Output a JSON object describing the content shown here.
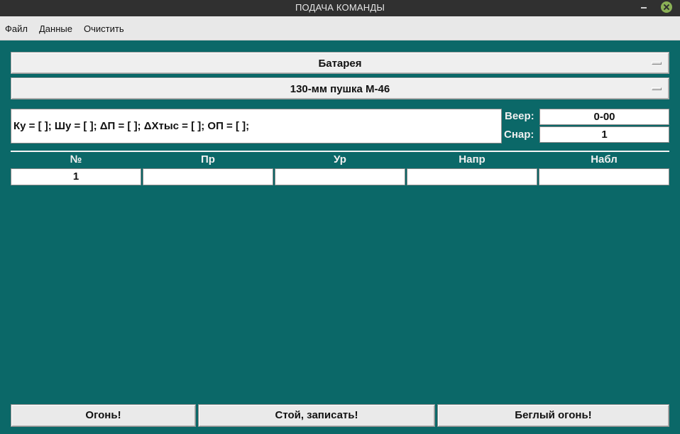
{
  "window": {
    "title": "ПОДАЧА КОМАНДЫ"
  },
  "menu": [
    "Файл",
    "Данные",
    "Очистить"
  ],
  "selectors": {
    "battery": "Батарея",
    "gun": "130-мм пушка М-46"
  },
  "formula": "Ку = [  ]; Шу = [  ]; ΔП = [  ]; ΔХтыс = [  ]; ОП = [  ];",
  "fields": {
    "veer": {
      "label": "Веер:",
      "value": "0-00"
    },
    "snar": {
      "label": "Снар:",
      "value": "1"
    }
  },
  "table": {
    "headers": [
      "№",
      "Пр",
      "Ур",
      "Напр",
      "Набл"
    ],
    "rows": [
      [
        "1",
        "",
        "",
        "",
        ""
      ]
    ]
  },
  "buttons": {
    "fire": "Огонь!",
    "stop_record": "Стой, записать!",
    "rapid_fire": "Беглый огонь!"
  }
}
